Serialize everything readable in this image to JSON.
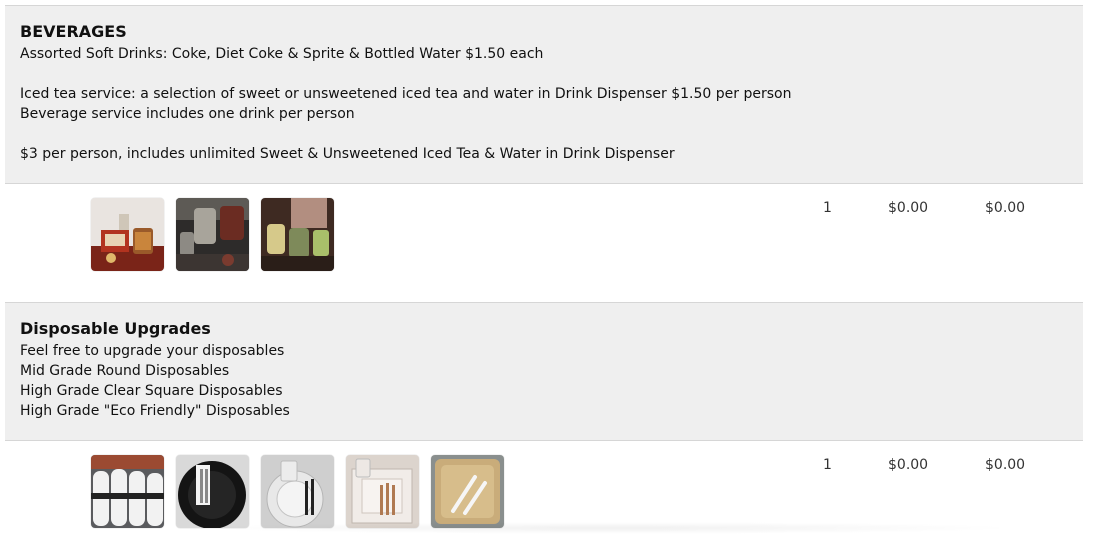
{
  "beverages": {
    "title": "BEVERAGES",
    "lines": [
      "Assorted Soft Drinks: Coke, Diet Coke & Sprite & Bottled Water $1.50 each",
      "Iced tea service: a selection of sweet or unsweetened iced tea and water in Drink Dispenser $1.50 per person",
      "Beverage service includes one drink per person",
      "$3 per person, includes unlimited Sweet & Unsweetened Iced Tea & Water in Drink Dispenser"
    ],
    "quantity": "1",
    "unit_price": "$0.00",
    "total": "$0.00",
    "photos": [
      "drink-dispenser-photo",
      "iced-tea-dispenser-photo",
      "beverage-station-photo"
    ]
  },
  "disposables": {
    "title": "Disposable Upgrades",
    "lines": [
      "Feel free to upgrade your disposables",
      "Mid Grade Round Disposables",
      "High Grade Clear Square Disposables",
      "High Grade \"Eco Friendly\" Disposables"
    ],
    "quantity": "1",
    "unit_price": "$0.00",
    "total": "$0.00",
    "photos": [
      "rolled-napkins-photo",
      "black-round-plates-photo",
      "clear-round-plates-photo",
      "clear-square-plates-photo",
      "palm-leaf-plates-photo"
    ]
  }
}
